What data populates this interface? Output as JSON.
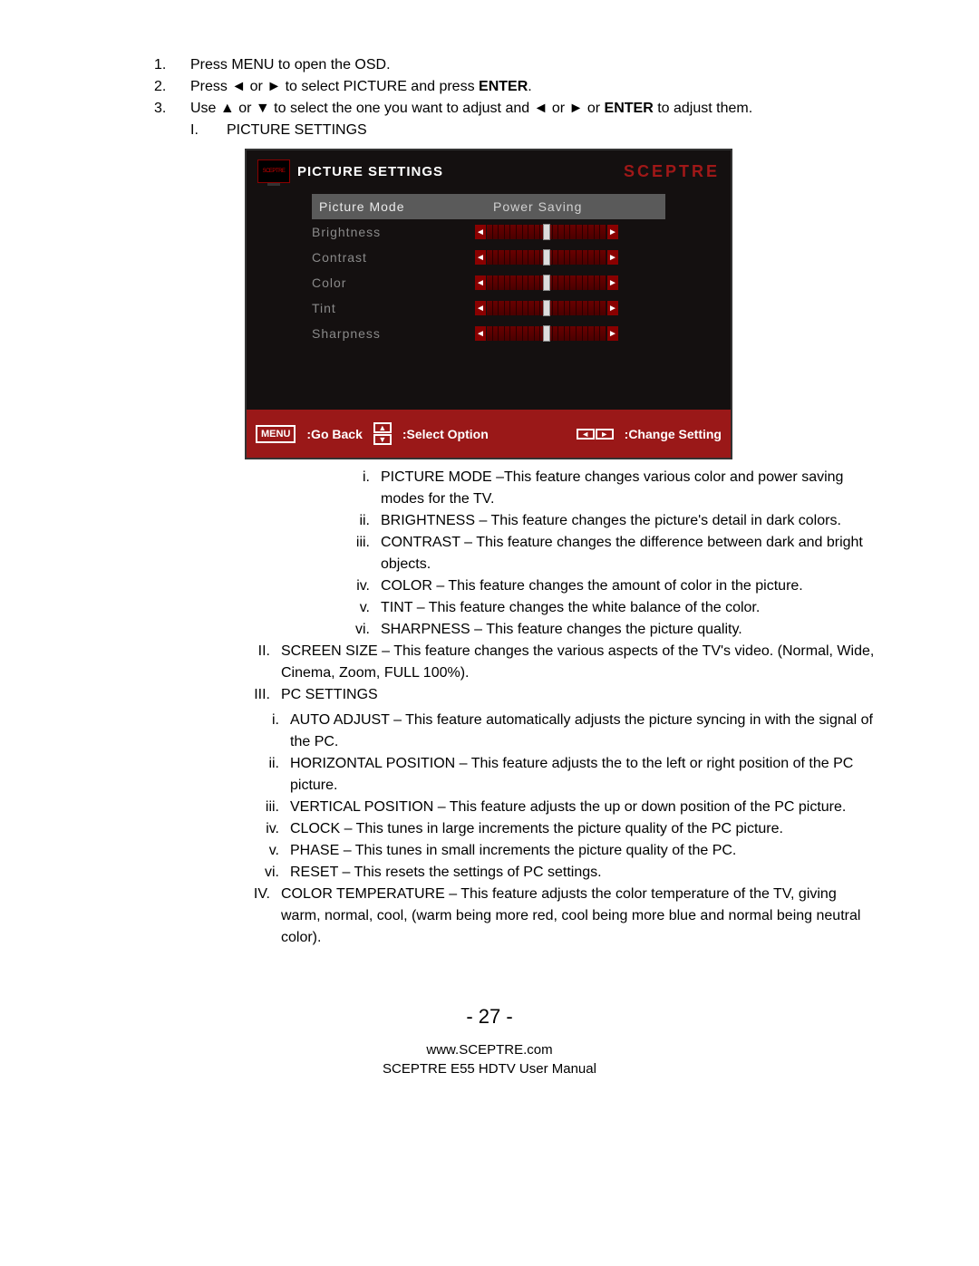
{
  "instructions": {
    "s1": "Press MENU to open the OSD.",
    "s2a": "Press ",
    "s2_l": "◄",
    "s2_or": " or ",
    "s2_r": "►",
    "s2b": " to select PICTURE and press ",
    "s2_enter": "ENTER",
    "s2c": ".",
    "s3a": "Use ",
    "s3_u": "▲",
    "s3_or1": " or ",
    "s3_d": "▼",
    "s3b": " to select the one you want to adjust and ",
    "s3_l": "◄",
    "s3_or2": " or ",
    "s3_r": "►",
    "s3_or3": " or ",
    "s3_enter": "ENTER",
    "s3c": " to adjust them.",
    "sub_I_num": "I.",
    "sub_I": "PICTURE SETTINGS"
  },
  "osd": {
    "tv_badge": "SCEPTRE",
    "title": "PICTURE SETTINGS",
    "brand": "SCEPTRE",
    "rows": {
      "picture_mode_label": "Picture Mode",
      "picture_mode_value": "Power Saving",
      "brightness": "Brightness",
      "contrast": "Contrast",
      "color": "Color",
      "tint": "Tint",
      "sharpness": "Sharpness"
    },
    "footer": {
      "menu": "MENU",
      "go_back": ":Go Back",
      "select": ":Select Option",
      "change": ":Change Setting",
      "up": "▲",
      "down": "▼",
      "left": "◄",
      "right": "►"
    }
  },
  "descI": {
    "i_num": "i.",
    "i": "PICTURE MODE –This feature changes various color and power saving modes for the TV.",
    "ii_num": "ii.",
    "ii": "BRIGHTNESS – This feature changes the picture's detail in dark colors.",
    "iii_num": "iii.",
    "iii": "CONTRAST – This feature changes the difference between dark and bright objects.",
    "iv_num": "iv.",
    "iv": "COLOR – This feature changes the amount of color in the picture.",
    "v_num": "v.",
    "v": "TINT – This feature changes the white balance of the color.",
    "vi_num": "vi.",
    "vi": "SHARPNESS – This feature changes the picture quality."
  },
  "roman": {
    "II_num": "II.",
    "II": "SCREEN SIZE – This feature changes the various aspects of the TV's video.  (Normal, Wide, Cinema, Zoom, FULL 100%).",
    "III_num": "III.",
    "III": "PC SETTINGS",
    "IV_num": "IV.",
    "IV": "COLOR TEMPERATURE – This feature adjusts the color temperature of the TV, giving warm, normal, cool, (warm being more red, cool being more blue and normal being neutral color)."
  },
  "descIII": {
    "i_num": "i.",
    "i": "AUTO ADJUST – This feature automatically adjusts the picture syncing in with the signal of the PC.",
    "ii_num": "ii.",
    "ii": "HORIZONTAL POSITION – This feature adjusts the to the left or right position of the PC picture.",
    "iii_num": "iii.",
    "iii": "VERTICAL POSITION – This feature adjusts the up or down position of the PC picture.",
    "iv_num": "iv.",
    "iv": "CLOCK – This tunes in large increments the picture quality of the PC picture.",
    "v_num": "v.",
    "v": "PHASE – This tunes in small increments the picture quality of the PC.",
    "vi_num": "vi.",
    "vi": "RESET – This resets the settings of PC settings."
  },
  "footer": {
    "page": "- 27 -",
    "url": "www.SCEPTRE.com",
    "manual": "SCEPTRE E55 HDTV User Manual"
  },
  "nums": {
    "n1": "1.",
    "n2": "2.",
    "n3": "3."
  }
}
